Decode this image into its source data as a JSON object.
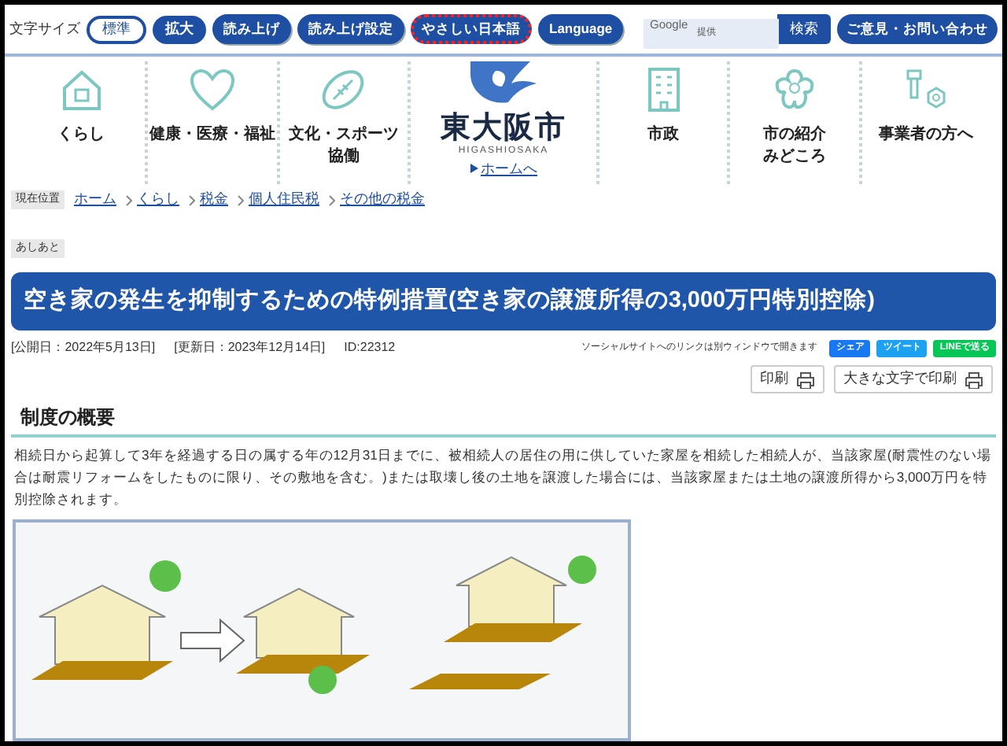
{
  "top_bar": {
    "font_size_label": "文字サイズ",
    "size_buttons": [
      {
        "label": "標準",
        "selected": true
      },
      {
        "label": "拡大",
        "selected": false
      }
    ],
    "tools": [
      {
        "label": "読み上げ",
        "focused": false
      },
      {
        "label": "読み上げ設定",
        "focused": false
      },
      {
        "label": "やさしい日本語",
        "focused": true
      },
      {
        "label": "Language",
        "focused": false
      }
    ],
    "search": {
      "placeholder": "提供",
      "brand": "Google",
      "button": "検索"
    },
    "contact_button": "ご意見・お問い合わせ"
  },
  "nav": {
    "left": [
      {
        "lines": [
          "くらし"
        ],
        "kind": "house"
      },
      {
        "lines": [
          "健康・医療・福祉"
        ],
        "kind": "heart"
      },
      {
        "lines": [
          "文化・スポーツ",
          "協働"
        ],
        "kind": "ball"
      }
    ],
    "logo": {
      "name": "東大阪市",
      "roman": "HIGASHIOSAKA",
      "home_link": "ホームへ"
    },
    "right": [
      {
        "lines": [
          "市政"
        ],
        "kind": "building"
      },
      {
        "lines": [
          "市の紹介",
          "みどころ"
        ],
        "kind": "flower"
      },
      {
        "lines": [
          "事業者の方へ"
        ],
        "kind": "tools"
      }
    ]
  },
  "breadcrumb": {
    "label": "現在位置",
    "items": [
      "ホーム",
      "くらし",
      "税金",
      "個人住民税",
      "その他の税金"
    ]
  },
  "footprints_label": "あしあと",
  "title": "空き家の発生を抑制するための特例措置(空き家の譲渡所得の3,000万円特別控除)",
  "meta": {
    "published": "[公開日：2022年5月13日]",
    "updated": "[更新日：2023年12月14日]",
    "id": "ID:22312",
    "social_note": "ソーシャルサイトへのリンクは別ウィンドウで開きます",
    "share_buttons": [
      {
        "label": "シェア",
        "color": "#1877f2"
      },
      {
        "label": "ツイート",
        "color": "#1da1f2"
      },
      {
        "label": "LINEで送る",
        "color": "#06c755"
      }
    ]
  },
  "print_buttons": [
    "印刷",
    "大きな文字で印刷"
  ],
  "section": {
    "heading": "制度の概要",
    "paragraph": "相続日から起算して3年を経過する日の属する年の12月31日までに、被相続人の居住の用に供していた家屋を相続した相続人が、当該家屋(耐震性のない場合は耐震リフォームをしたものに限り、その敷地を含む。)または取壊し後の土地を譲渡した場合には、当該家屋または土地の譲渡所得から3,000万円を特別控除されます。"
  }
}
